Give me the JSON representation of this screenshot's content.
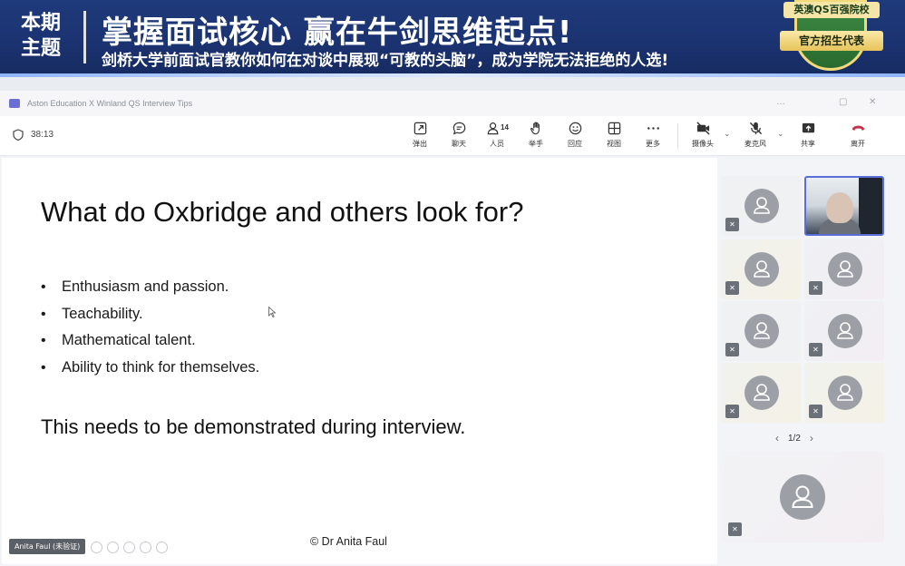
{
  "banner": {
    "tag_line1": "本期",
    "tag_line2": "主题",
    "title": "掌握面试核心  赢在牛剑思维起点!",
    "subtitle": "剑桥大学前面试官教你如何在对谈中展现“可教的头脑”，成为学院无法拒绝的人选!",
    "badge_top": "英澳QS百强院校",
    "badge_ribbon": "官方招生代表"
  },
  "window": {
    "title": "Aston Education X Winland QS Interview Tips",
    "controls": [
      "…",
      "▢",
      "✕"
    ]
  },
  "toolbar": {
    "timer": "38:13",
    "buttons": [
      {
        "label": "弹出",
        "icon": "popout-icon"
      },
      {
        "label": "聊天",
        "icon": "chat-icon"
      },
      {
        "label": "人员",
        "icon": "people-icon",
        "count": "14"
      },
      {
        "label": "举手",
        "icon": "raise-hand-icon"
      },
      {
        "label": "回应",
        "icon": "react-icon"
      },
      {
        "label": "视图",
        "icon": "view-icon"
      },
      {
        "label": "更多",
        "icon": "more-icon"
      },
      {
        "label": "摄像头",
        "icon": "camera-off-icon"
      },
      {
        "label": "麦克风",
        "icon": "mic-off-icon"
      },
      {
        "label": "共享",
        "icon": "share-icon"
      },
      {
        "label": "离开",
        "icon": "leave-icon"
      }
    ]
  },
  "slide": {
    "title": "What do Oxbridge and others look for?",
    "bullets": [
      "Enthusiasm and passion.",
      "Teachability.",
      "Mathematical talent.",
      "Ability to think for themselves."
    ],
    "note": "This needs to be demonstrated during interview.",
    "copyright": "© Dr Anita Faul",
    "presenter_tag": "Anita Faul (未验证)"
  },
  "participants": {
    "pager": "1/2",
    "accent": "#5b6dd6"
  }
}
